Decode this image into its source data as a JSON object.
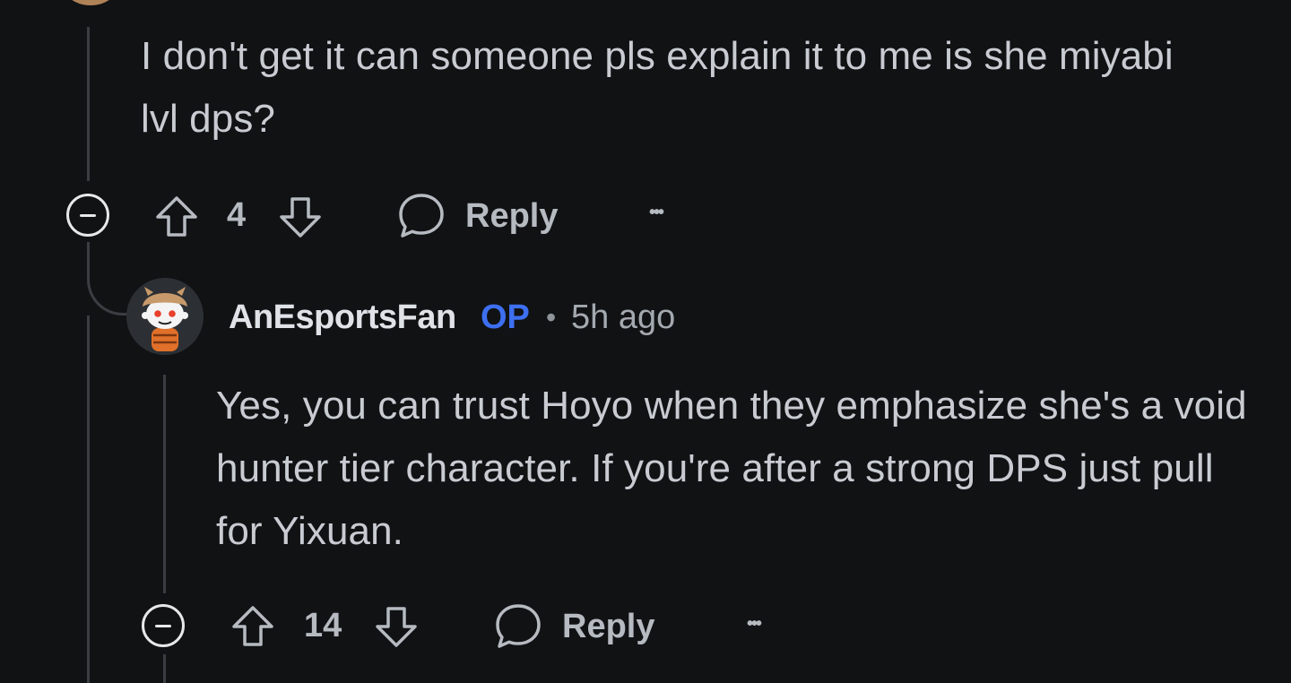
{
  "parent_comment": {
    "body": "I don't get it can someone pls explain it to me is she miyabi lvl dps?",
    "score": "4",
    "reply_label": "Reply",
    "more_label": "•••"
  },
  "reply_comment": {
    "username": "AnEsportsFan",
    "op_badge": "OP",
    "separator": "•",
    "time_ago": "5h ago",
    "body": "Yes, you can trust Hoyo when they emphasize she's a void hunter tier character. If you're after a strong DPS just pull for Yixuan.",
    "score": "14",
    "reply_label": "Reply",
    "more_label": "•••"
  },
  "icons": {
    "collapse": "minus-circle-icon",
    "upvote": "arrow-up-icon",
    "downvote": "arrow-down-icon",
    "reply": "speech-bubble-icon",
    "more": "ellipsis-icon"
  },
  "colors": {
    "background": "#101214",
    "text": "#c8ccd2",
    "username": "#dfe2e6",
    "op_badge": "#3d6ff0",
    "meta": "#a4a9b0",
    "thread_line": "#3a3e43"
  }
}
